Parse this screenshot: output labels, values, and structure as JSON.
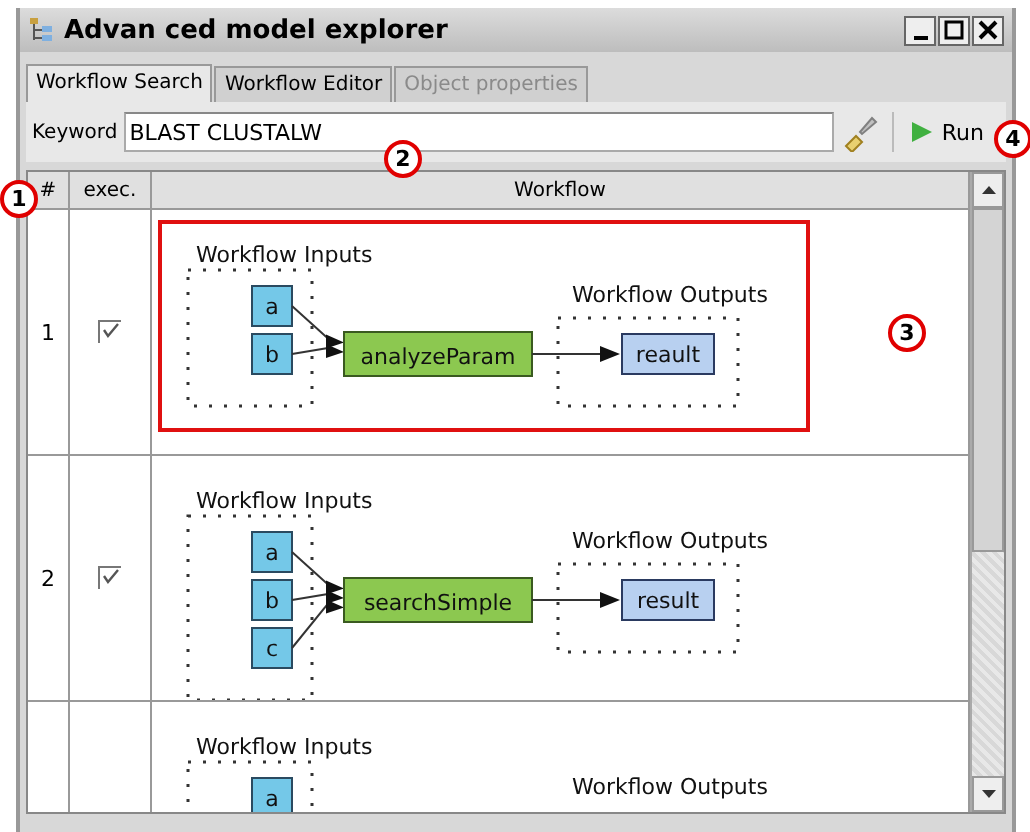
{
  "window": {
    "title": "Advan ced model explorer"
  },
  "tabs": [
    {
      "label": "Workflow Search",
      "selected": true,
      "disabled": false
    },
    {
      "label": "Workflow Editor",
      "selected": false,
      "disabled": false
    },
    {
      "label": "Object properties",
      "selected": false,
      "disabled": true
    }
  ],
  "search": {
    "label": "Keyword",
    "value": "BLAST CLUSTALW",
    "run_label": "Run"
  },
  "table": {
    "columns": [
      "#",
      "exec.",
      "Workflow"
    ],
    "rows": [
      {
        "number": "1",
        "exec": true,
        "highlighted": true,
        "workflow": {
          "inputs_title": "Workflow Inputs",
          "inputs": [
            "a",
            "b"
          ],
          "process": "analyzeParam",
          "outputs_title": "Workflow Outputs",
          "outputs": [
            "reault"
          ]
        }
      },
      {
        "number": "2",
        "exec": true,
        "highlighted": false,
        "workflow": {
          "inputs_title": "Workflow Inputs",
          "inputs": [
            "a",
            "b",
            "c"
          ],
          "process": "searchSimple",
          "outputs_title": "Workflow Outputs",
          "outputs": [
            "result"
          ]
        }
      },
      {
        "workflow": {
          "inputs_title": "Workflow Inputs",
          "inputs": [
            "a"
          ],
          "outputs_title": "Workflow Outputs"
        }
      }
    ]
  },
  "callouts": [
    "1",
    "2",
    "3",
    "4"
  ]
}
